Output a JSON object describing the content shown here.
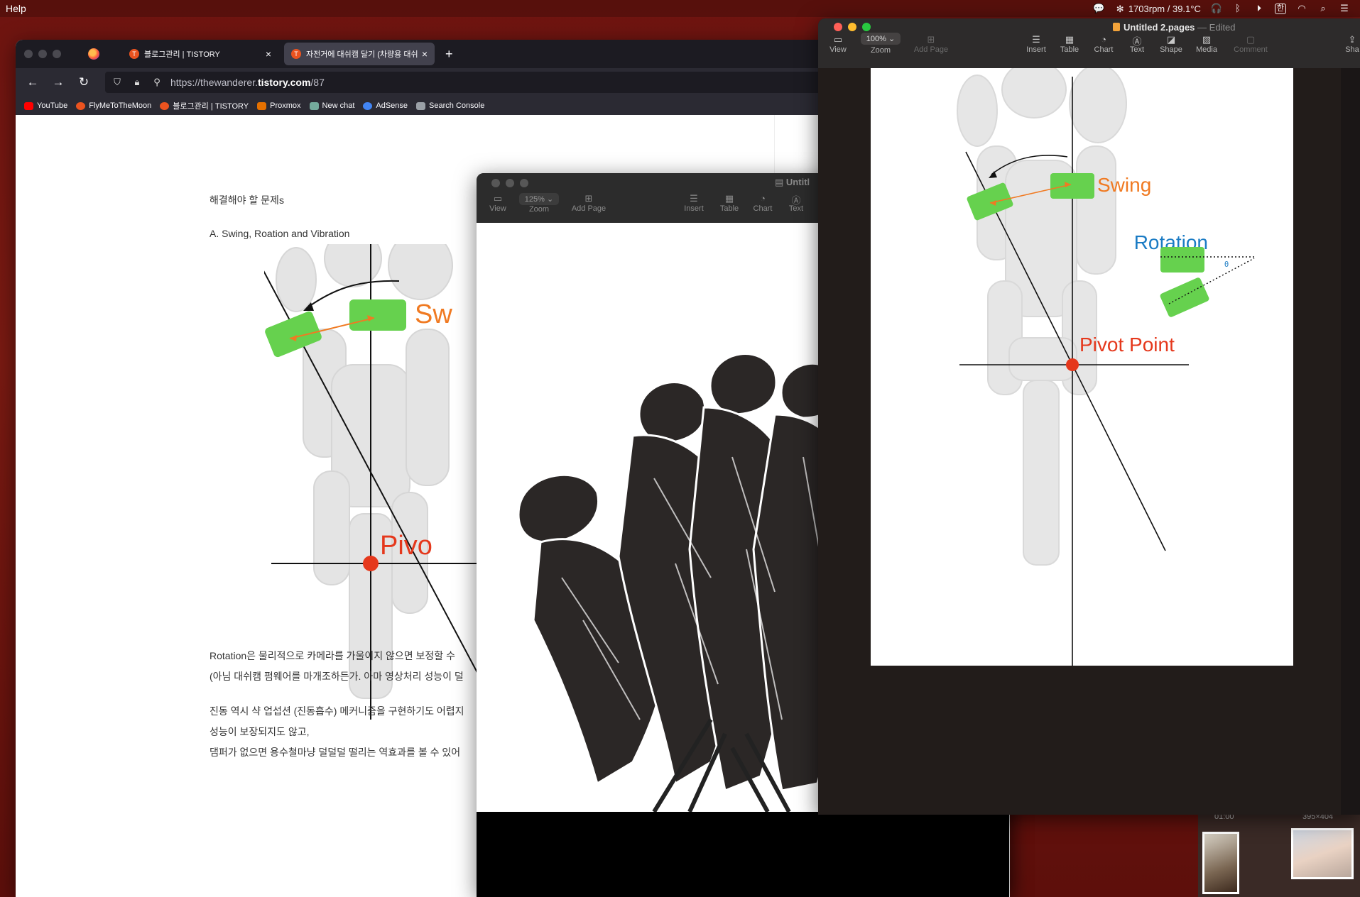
{
  "menubar": {
    "help": "Help",
    "fan_status": "1703rpm / 39.1°C",
    "input_method": "한"
  },
  "browser": {
    "tabs": [
      {
        "label": "블로그관리 | TISTORY",
        "active": false
      },
      {
        "label": "자전거에 대쉬캠 달기 (차량용 대쉬캠",
        "active": true
      }
    ],
    "url_prefix": "https://thewanderer.",
    "url_host": "tistory.com",
    "url_path": "/87",
    "bookmarks": [
      {
        "label": "YouTube",
        "color": "#ff0000"
      },
      {
        "label": "FlyMeToTheMoon",
        "color": "#eb531f"
      },
      {
        "label": "블로그관리 | TISTORY",
        "color": "#eb531f"
      },
      {
        "label": "Proxmox",
        "color": "#e57000"
      },
      {
        "label": "New chat",
        "color": "#74aa9c"
      },
      {
        "label": "AdSense",
        "color": "#4285f4"
      },
      {
        "label": "Search Console",
        "color": "#9aa0a6"
      }
    ],
    "page": {
      "heading1": "해결해야 할 문제s",
      "heading2": "A. Swing, Roation and Vibration",
      "para1": "Rotation은 물리적으로 카메라를 가울이지 않으면 보정할 수",
      "para2": "(아님 대쉬캠 펌웨어를 마개조하든가. 아마 영상처리 성능이 덜",
      "para3": "진동 역시 샥 업섭션 (진동흡수) 메커니즘을 구현하기도 어렵지",
      "para4": "성능이 보장되지도 않고,",
      "para5": "댐퍼가 없으면 용수철마냥 덜덜덜 떨리는 역효과를 볼 수 있어",
      "fig_swing": "Sw",
      "fig_pivot": "Pivo"
    }
  },
  "pages_small": {
    "title": "Untitl",
    "zoom": "125%",
    "toolbar": {
      "view": "View",
      "zoom": "Zoom",
      "add_page": "Add Page",
      "insert": "Insert",
      "table": "Table",
      "chart": "Chart",
      "text": "Text"
    }
  },
  "pages_main": {
    "title": "Untitled 2.pages",
    "status": "— Edited",
    "zoom": "100%",
    "toolbar": {
      "view": "View",
      "zoom": "Zoom",
      "add_page": "Add Page",
      "insert": "Insert",
      "table": "Table",
      "chart": "Chart",
      "text": "Text",
      "shape": "Shape",
      "media": "Media",
      "comment": "Comment",
      "share": "Sha"
    },
    "figure": {
      "swing": "Swing",
      "rotation": "Rotation",
      "pivot": "Pivot Point",
      "angle": "θ"
    }
  },
  "dock": {
    "time": "01:00",
    "size": "395×404"
  },
  "colors": {
    "swing": "#f07a22",
    "rotation": "#1a7bc4",
    "pivot": "#e5381c",
    "camera": "#66d14e"
  }
}
